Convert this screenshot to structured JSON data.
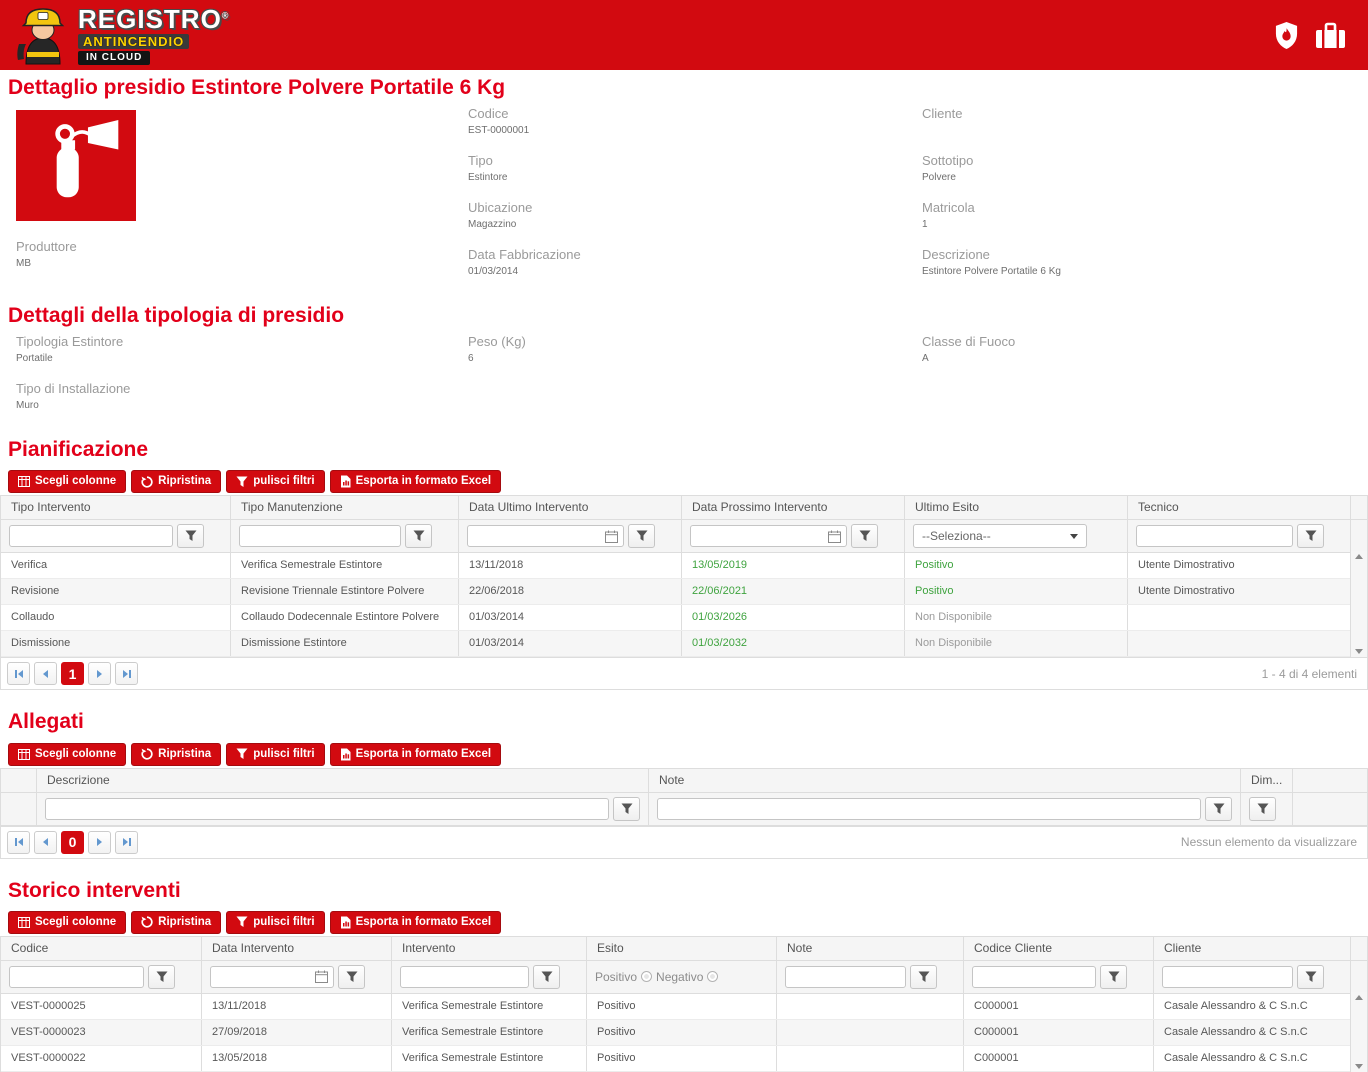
{
  "colors": {
    "brand_red": "#d20a10",
    "title_red": "#e2001a",
    "positive_green": "#3fa33f",
    "muted_gray": "#9b9b9b"
  },
  "header": {
    "logo_line1": "REGISTRO",
    "logo_reg": "®",
    "logo_line2": "ANTINCENDIO",
    "logo_line3": "IN CLOUD"
  },
  "detail": {
    "title": "Dettaglio presidio Estintore Polvere Portatile 6 Kg",
    "produttore": {
      "label": "Produttore",
      "value": "MB"
    },
    "col2": [
      {
        "label": "Codice",
        "value": "EST-0000001"
      },
      {
        "label": "Tipo",
        "value": "Estintore"
      },
      {
        "label": "Ubicazione",
        "value": "Magazzino"
      },
      {
        "label": "Data Fabbricazione",
        "value": "01/03/2014"
      }
    ],
    "col3": [
      {
        "label": "Cliente",
        "value": ""
      },
      {
        "label": "Sottotipo",
        "value": "Polvere"
      },
      {
        "label": "Matricola",
        "value": "1"
      },
      {
        "label": "Descrizione",
        "value": "Estintore Polvere Portatile 6 Kg"
      }
    ]
  },
  "tipologia": {
    "title": "Dettagli della tipologia di presidio",
    "fields": [
      {
        "label": "Tipologia Estintore",
        "value": "Portatile"
      },
      {
        "label": "Peso (Kg)",
        "value": "6"
      },
      {
        "label": "Classe di Fuoco",
        "value": "A"
      },
      {
        "label": "Tipo di Installazione",
        "value": "Muro"
      }
    ]
  },
  "toolbar": {
    "scegli_colonne": "Scegli colonne",
    "ripristina": "Ripristina",
    "pulisci_filtri": "pulisci filtri",
    "esporta_excel": "Esporta in formato Excel"
  },
  "pianificazione": {
    "title": "Pianificazione",
    "columns": [
      "Tipo Intervento",
      "Tipo Manutenzione",
      "Data Ultimo Intervento",
      "Data Prossimo Intervento",
      "Ultimo Esito",
      "Tecnico"
    ],
    "esito_select_value": "--Seleziona--",
    "rows": [
      {
        "tipo_intervento": "Verifica",
        "tipo_manutenzione": "Verifica Semestrale Estintore",
        "data_ultimo": "13/11/2018",
        "data_prossimo": "13/05/2019",
        "esito": "Positivo",
        "esito_class": "text-green",
        "tecnico": "Utente Dimostrativo"
      },
      {
        "tipo_intervento": "Revisione",
        "tipo_manutenzione": "Revisione Triennale Estintore Polvere",
        "data_ultimo": "22/06/2018",
        "data_prossimo": "22/06/2021",
        "esito": "Positivo",
        "esito_class": "text-green",
        "tecnico": "Utente Dimostrativo"
      },
      {
        "tipo_intervento": "Collaudo",
        "tipo_manutenzione": "Collaudo Dodecennale Estintore Polvere",
        "data_ultimo": "01/03/2014",
        "data_prossimo": "01/03/2026",
        "esito": "Non Disponibile",
        "esito_class": "text-gray",
        "tecnico": ""
      },
      {
        "tipo_intervento": "Dismissione",
        "tipo_manutenzione": "Dismissione Estintore",
        "data_ultimo": "01/03/2014",
        "data_prossimo": "01/03/2032",
        "esito": "Non Disponibile",
        "esito_class": "text-gray",
        "tecnico": ""
      }
    ],
    "pager": {
      "page": "1",
      "summary": "1 - 4 di 4 elementi"
    }
  },
  "allegati": {
    "title": "Allegati",
    "columns": {
      "descrizione": "Descrizione",
      "note": "Note",
      "dim": "Dim..."
    },
    "pager": {
      "page": "0",
      "summary": "Nessun elemento da visualizzare"
    }
  },
  "storico": {
    "title": "Storico interventi",
    "columns": [
      "Codice",
      "Data Intervento",
      "Intervento",
      "Esito",
      "Note",
      "Codice Cliente",
      "Cliente"
    ],
    "esito_filter_positivo": "Positivo",
    "esito_filter_negativo": "Negativo",
    "rows": [
      {
        "codice": "VEST-0000025",
        "data": "13/11/2018",
        "intervento": "Verifica Semestrale Estintore",
        "esito": "Positivo",
        "note": "",
        "codice_cliente": "C000001",
        "cliente": "Casale Alessandro & C S.n.C"
      },
      {
        "codice": "VEST-0000023",
        "data": "27/09/2018",
        "intervento": "Verifica Semestrale Estintore",
        "esito": "Positivo",
        "note": "",
        "codice_cliente": "C000001",
        "cliente": "Casale Alessandro & C S.n.C"
      },
      {
        "codice": "VEST-0000022",
        "data": "13/05/2018",
        "intervento": "Verifica Semestrale Estintore",
        "esito": "Positivo",
        "note": "",
        "codice_cliente": "C000001",
        "cliente": "Casale Alessandro & C S.n.C"
      }
    ]
  }
}
